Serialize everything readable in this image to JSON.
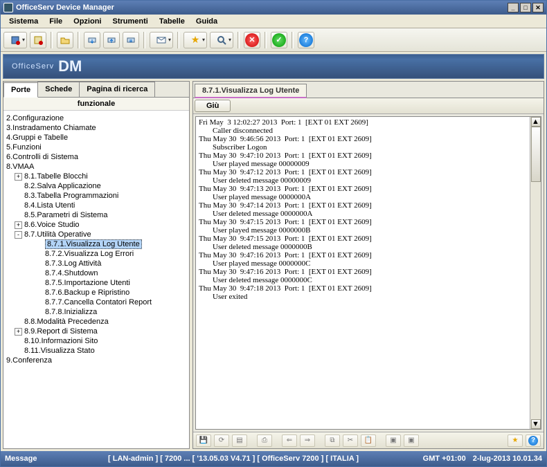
{
  "title": "OfficeServ Device Manager",
  "menu": [
    "Sistema",
    "File",
    "Opzioni",
    "Strumenti",
    "Tabelle",
    "Guida"
  ],
  "banner": {
    "a": "OfficeServ",
    "b": "DM"
  },
  "left": {
    "tabs": [
      "Porte",
      "Schede",
      "Pagina di ricerca"
    ],
    "active_tab": 0,
    "tree_header": "funzionale",
    "nodes": [
      {
        "depth": 0,
        "exp": "",
        "label": "2.Configurazione"
      },
      {
        "depth": 0,
        "exp": "",
        "label": "3.Instradamento Chiamate"
      },
      {
        "depth": 0,
        "exp": "",
        "label": "4.Gruppi e Tabelle"
      },
      {
        "depth": 0,
        "exp": "",
        "label": "5.Funzioni"
      },
      {
        "depth": 0,
        "exp": "",
        "label": "6.Controlli di Sistema"
      },
      {
        "depth": 0,
        "exp": "",
        "label": "8.VMAA"
      },
      {
        "depth": 1,
        "exp": "+",
        "label": "8.1.Tabelle Blocchi"
      },
      {
        "depth": 1,
        "exp": "",
        "label": "8.2.Salva Applicazione"
      },
      {
        "depth": 1,
        "exp": "",
        "label": "8.3.Tabella Programmazioni"
      },
      {
        "depth": 1,
        "exp": "",
        "label": "8.4.Lista Utenti"
      },
      {
        "depth": 1,
        "exp": "",
        "label": "8.5.Parametri di Sistema"
      },
      {
        "depth": 1,
        "exp": "+",
        "label": "8.6.Voice Studio"
      },
      {
        "depth": 1,
        "exp": "-",
        "label": "8.7.Utilità Operative"
      },
      {
        "depth": 2,
        "exp": "",
        "label": "8.7.1.Visualizza Log Utente",
        "selected": true
      },
      {
        "depth": 2,
        "exp": "",
        "label": "8.7.2.Visualizza Log Errori"
      },
      {
        "depth": 2,
        "exp": "",
        "label": "8.7.3.Log Attività"
      },
      {
        "depth": 2,
        "exp": "",
        "label": "8.7.4.Shutdown"
      },
      {
        "depth": 2,
        "exp": "",
        "label": "8.7.5.Importazione Utenti"
      },
      {
        "depth": 2,
        "exp": "",
        "label": "8.7.6.Backup e Ripristino"
      },
      {
        "depth": 2,
        "exp": "",
        "label": "8.7.7.Cancella Contatori Report"
      },
      {
        "depth": 2,
        "exp": "",
        "label": "8.7.8.Inizializza"
      },
      {
        "depth": 1,
        "exp": "",
        "label": "8.8.Modalità Precedenza"
      },
      {
        "depth": 1,
        "exp": "+",
        "label": "8.9.Report di Sistema"
      },
      {
        "depth": 1,
        "exp": "",
        "label": "8.10.Informazioni Sito"
      },
      {
        "depth": 1,
        "exp": "",
        "label": "8.11.Visualizza Stato"
      },
      {
        "depth": 0,
        "exp": "",
        "label": "9.Conferenza"
      }
    ]
  },
  "right": {
    "tab": "8.7.1.Visualizza Log Utente",
    "button": "Giù",
    "log": [
      {
        "t": "Fri May  3 12:02:27 2013  Port: 1  [EXT 01 EXT 2609]"
      },
      {
        "t": "Caller disconnected",
        "d": true
      },
      {
        "t": "Thu May 30  9:46:56 2013  Port: 1  [EXT 01 EXT 2609]"
      },
      {
        "t": "Subscriber Logon",
        "d": true
      },
      {
        "t": "Thu May 30  9:47:10 2013  Port: 1  [EXT 01 EXT 2609]"
      },
      {
        "t": "User played message 00000009",
        "d": true
      },
      {
        "t": "Thu May 30  9:47:12 2013  Port: 1  [EXT 01 EXT 2609]"
      },
      {
        "t": "User deleted message 00000009",
        "d": true
      },
      {
        "t": "Thu May 30  9:47:13 2013  Port: 1  [EXT 01 EXT 2609]"
      },
      {
        "t": "User played message 0000000A",
        "d": true
      },
      {
        "t": "Thu May 30  9:47:14 2013  Port: 1  [EXT 01 EXT 2609]"
      },
      {
        "t": "User deleted message 0000000A",
        "d": true
      },
      {
        "t": "Thu May 30  9:47:15 2013  Port: 1  [EXT 01 EXT 2609]"
      },
      {
        "t": "User played message 0000000B",
        "d": true
      },
      {
        "t": "Thu May 30  9:47:15 2013  Port: 1  [EXT 01 EXT 2609]"
      },
      {
        "t": "User deleted message 0000000B",
        "d": true
      },
      {
        "t": "Thu May 30  9:47:16 2013  Port: 1  [EXT 01 EXT 2609]"
      },
      {
        "t": "User played message 0000000C",
        "d": true
      },
      {
        "t": "Thu May 30  9:47:16 2013  Port: 1  [EXT 01 EXT 2609]"
      },
      {
        "t": "User deleted message 0000000C",
        "d": true
      },
      {
        "t": "Thu May 30  9:47:18 2013  Port: 1  [EXT 01 EXT 2609]"
      },
      {
        "t": "User exited",
        "d": true
      }
    ]
  },
  "status": {
    "label": "Message",
    "mid": "[ LAN-admin ] [ 7200 ... [ '13.05.03 V4.71 ] [ OfficeServ 7200 ]       [ ITALIA ]",
    "tz": "GMT +01:00",
    "time": "2-lug-2013 10.01.34"
  }
}
